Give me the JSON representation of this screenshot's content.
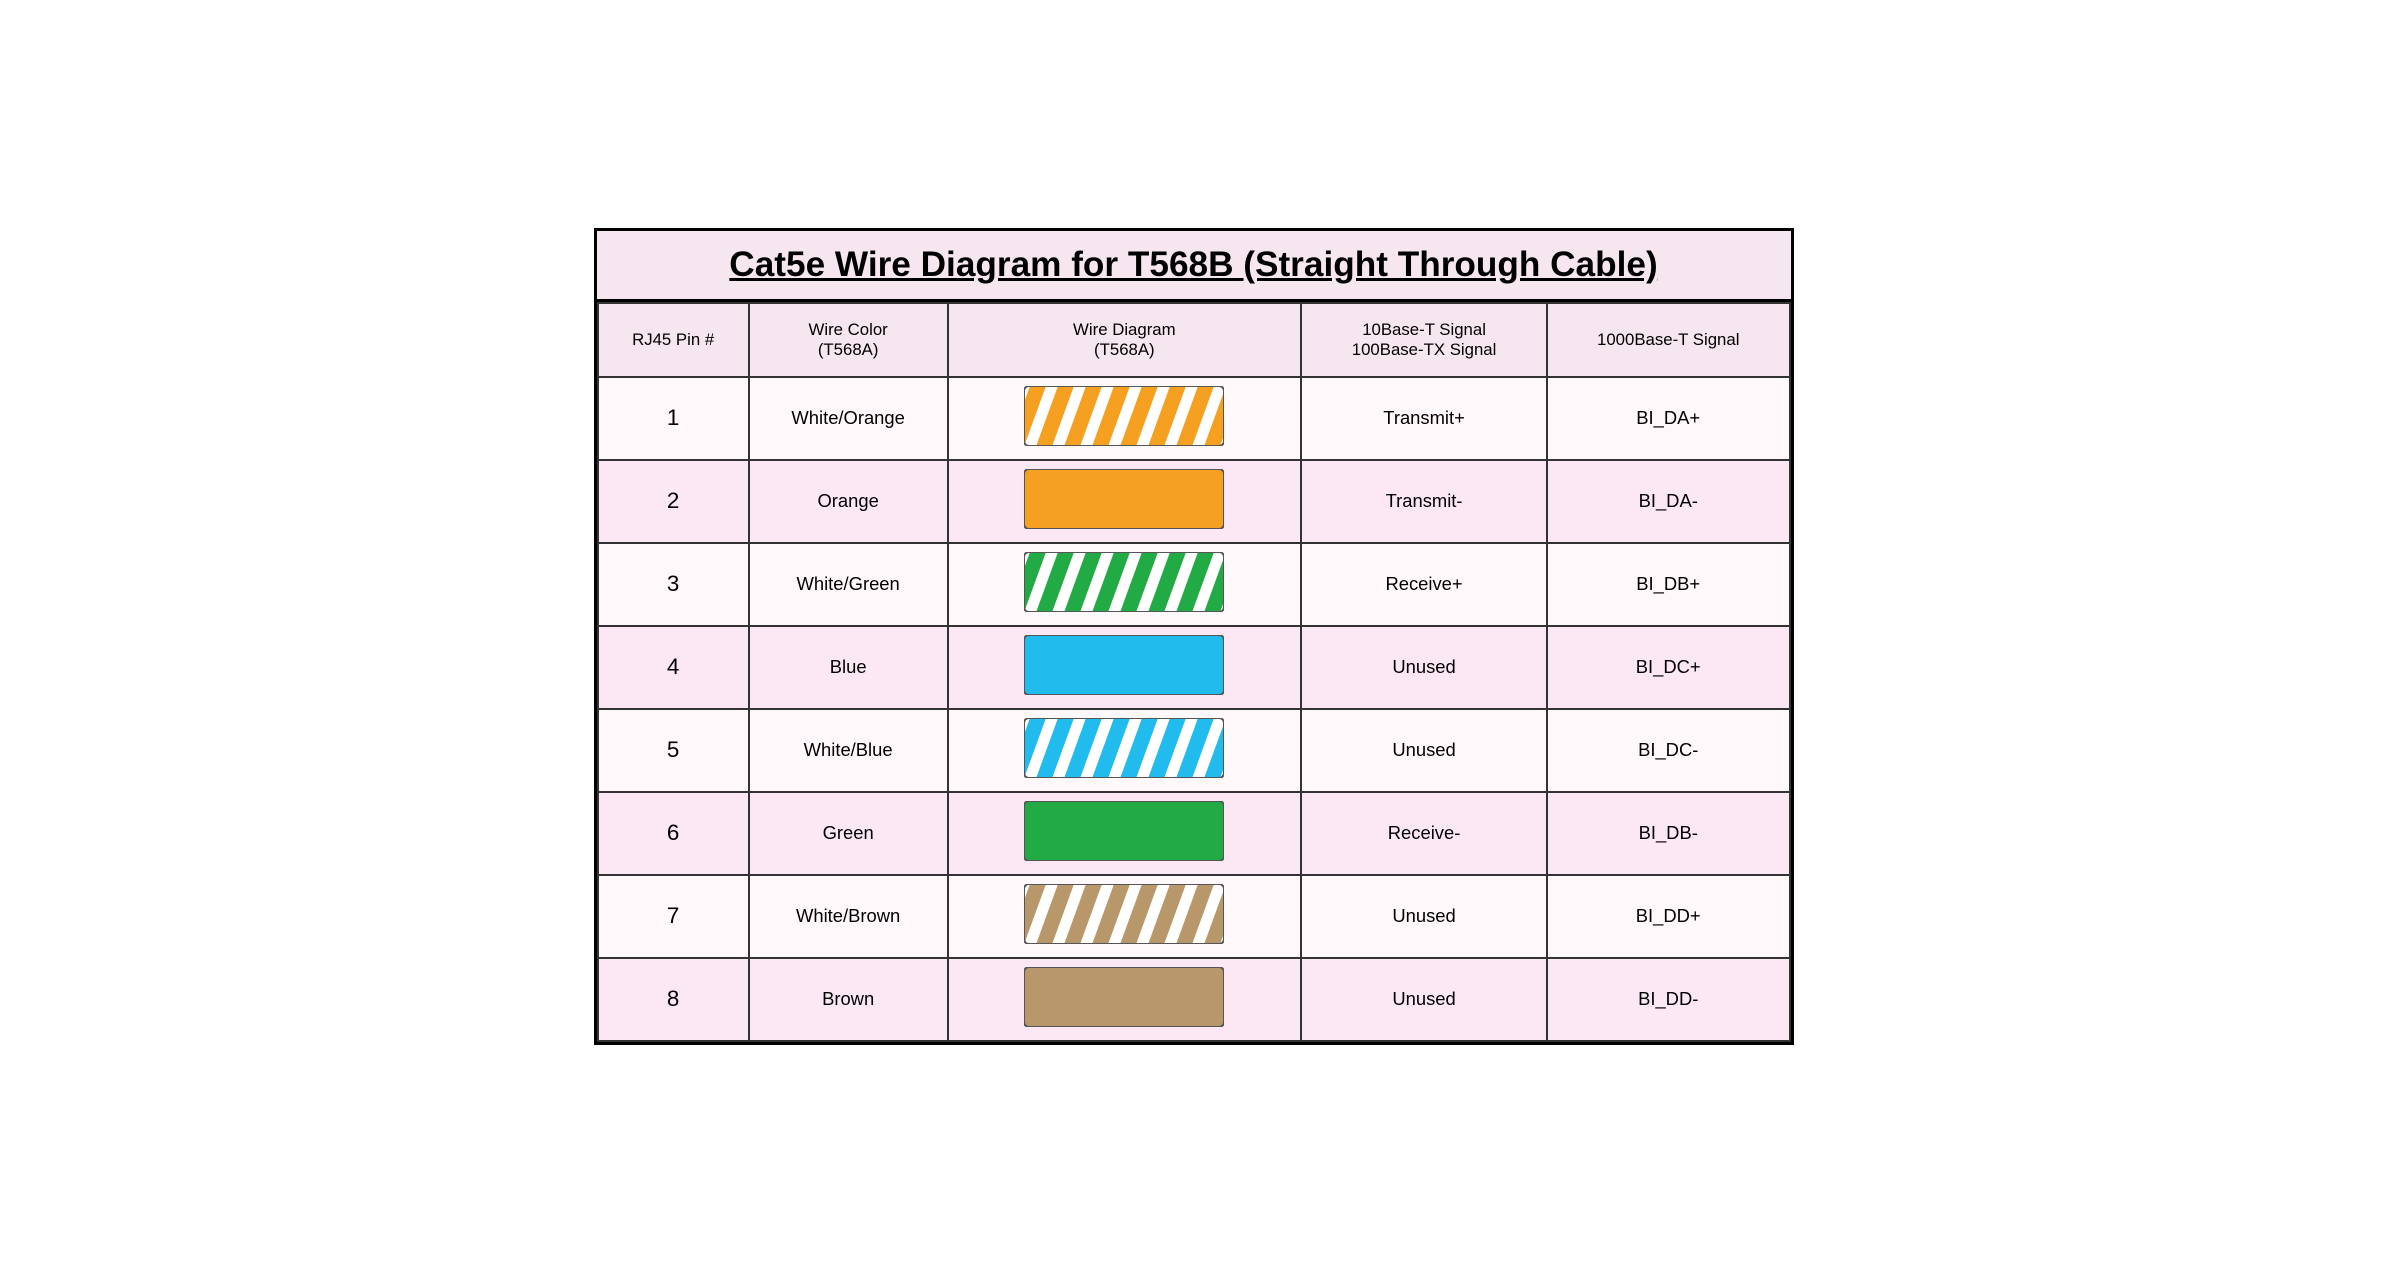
{
  "title": "Cat5e Wire Diagram for T568B (Straight Through Cable)",
  "headers": {
    "col1": "RJ45 Pin #",
    "col2": "Wire Color\n(T568A)",
    "col3": "Wire Diagram\n(T568A)",
    "col4": "10Base-T Signal\n100Base-TX Signal",
    "col5": "1000Base-T Signal"
  },
  "rows": [
    {
      "pin": "1",
      "color": "White/Orange",
      "diagram": "white-orange-stripe",
      "signal10_100": "Transmit+",
      "signal1000": "BI_DA+"
    },
    {
      "pin": "2",
      "color": "Orange",
      "diagram": "orange-solid",
      "signal10_100": "Transmit-",
      "signal1000": "BI_DA-"
    },
    {
      "pin": "3",
      "color": "White/Green",
      "diagram": "white-green-stripe",
      "signal10_100": "Receive+",
      "signal1000": "BI_DB+"
    },
    {
      "pin": "4",
      "color": "Blue",
      "diagram": "blue-solid",
      "signal10_100": "Unused",
      "signal1000": "BI_DC+"
    },
    {
      "pin": "5",
      "color": "White/Blue",
      "diagram": "white-blue-stripe",
      "signal10_100": "Unused",
      "signal1000": "BI_DC-"
    },
    {
      "pin": "6",
      "color": "Green",
      "diagram": "green-solid",
      "signal10_100": "Receive-",
      "signal1000": "BI_DB-"
    },
    {
      "pin": "7",
      "color": "White/Brown",
      "diagram": "white-brown-stripe",
      "signal10_100": "Unused",
      "signal1000": "BI_DD+"
    },
    {
      "pin": "8",
      "color": "Brown",
      "diagram": "brown-solid",
      "signal10_100": "Unused",
      "signal1000": "BI_DD-"
    }
  ],
  "wire_colors": {
    "orange": "#F5A020",
    "green": "#22AA44",
    "blue": "#22BBEE",
    "brown": "#B8986A",
    "white": "#FFFFFF"
  }
}
